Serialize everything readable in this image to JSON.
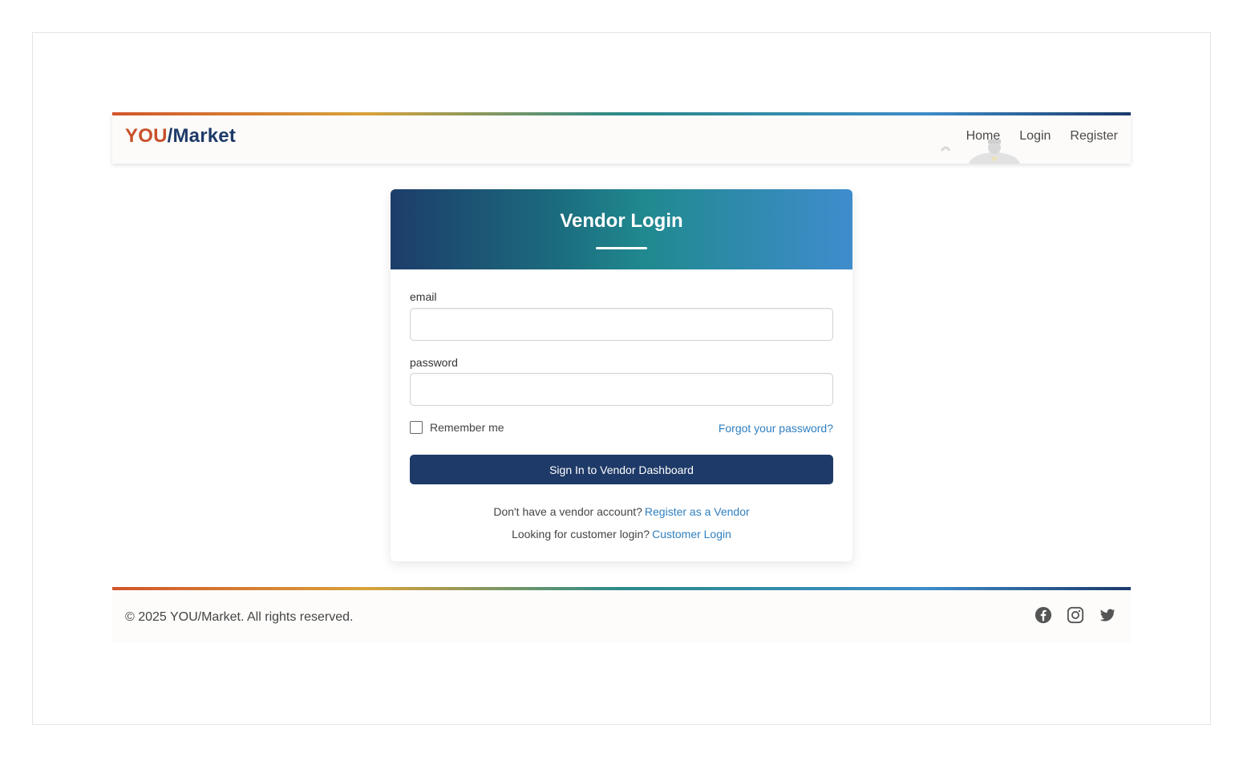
{
  "header": {
    "logo_you": "YOU",
    "logo_slash_market": "/Market",
    "nav": [
      {
        "label": "Home"
      },
      {
        "label": "Login"
      },
      {
        "label": "Register"
      }
    ]
  },
  "login_card": {
    "title": "Vendor Login",
    "email_label": "email",
    "password_label": "password",
    "remember_label": "Remember me",
    "remember_checked": false,
    "forgot_link": "Forgot your password?",
    "submit_label": "Sign In to Vendor Dashboard",
    "no_account_text": "Don't have a vendor account?",
    "register_link": "Register as a Vendor",
    "customer_text": "Looking for customer login?",
    "customer_link": "Customer Login"
  },
  "footer": {
    "copyright": "© 2025 YOU/Market. All rights reserved.",
    "social_icons": [
      "facebook-icon",
      "instagram-icon",
      "twitter-icon"
    ]
  },
  "colors": {
    "brand_orange": "#c9502a",
    "brand_navy": "#1e3a68",
    "link_blue": "#2f7fc0",
    "button_bg": "#1e3a68"
  }
}
